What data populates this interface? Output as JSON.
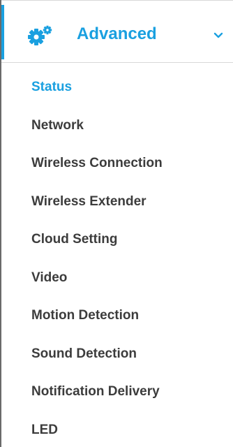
{
  "header": {
    "title": "Advanced",
    "icon": "gears-icon",
    "expand_icon": "chevron-down-icon",
    "accent_color": "#1aa0e0"
  },
  "menu": {
    "items": [
      {
        "label": "Status",
        "active": true
      },
      {
        "label": "Network",
        "active": false
      },
      {
        "label": "Wireless Connection",
        "active": false
      },
      {
        "label": "Wireless Extender",
        "active": false
      },
      {
        "label": "Cloud Setting",
        "active": false
      },
      {
        "label": "Video",
        "active": false
      },
      {
        "label": "Motion Detection",
        "active": false
      },
      {
        "label": "Sound Detection",
        "active": false
      },
      {
        "label": "Notification Delivery",
        "active": false
      },
      {
        "label": "LED",
        "active": false
      }
    ]
  }
}
